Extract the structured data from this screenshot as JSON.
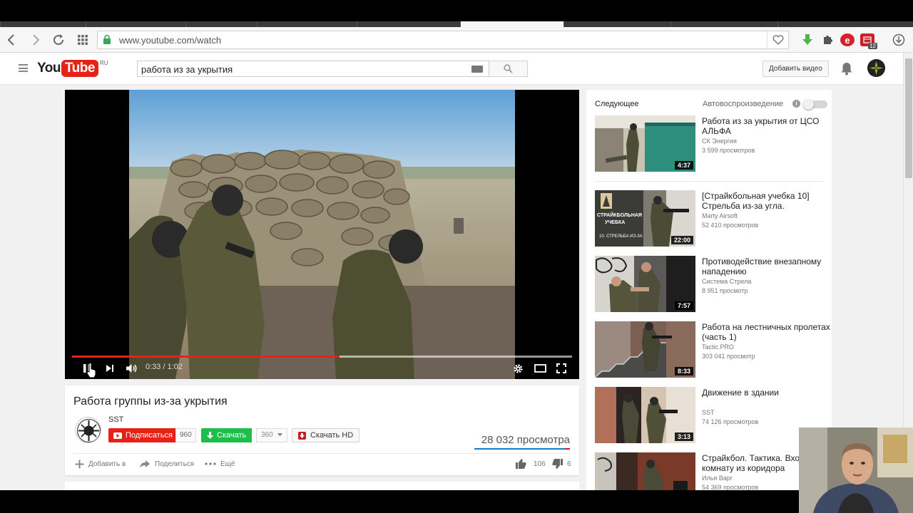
{
  "browser": {
    "url": "www.youtube.com/watch",
    "extension_badge": "12"
  },
  "masthead": {
    "logo_you": "You",
    "logo_tube": "Tube",
    "logo_region": "RU",
    "search_value": "работа из за укрытия",
    "upload_label": "Добавить видео"
  },
  "player": {
    "time": "0:33 / 1:02",
    "progress": 0.535,
    "buffered": 1.0
  },
  "video": {
    "title": "Работа группы из-за укрытия",
    "channel": "SST",
    "subscribe_label": "Подписаться",
    "subscribers": "960",
    "download_label": "Скачать",
    "download_count": "360",
    "download_hd_label": "Скачать HD",
    "views": "28 032 просмотра",
    "add_to_label": "Добавить в",
    "share_label": "Поделиться",
    "more_label": "Ещё",
    "likes": "106",
    "dislikes": "6",
    "like_ratio": 0.946
  },
  "sidebar": {
    "up_next_label": "Следующее",
    "autoplay_label": "Автовоспроизведение",
    "recommendations": [
      {
        "title": "Работа из за укрытия от ЦСО АЛЬФА",
        "channel": "СК Энергия",
        "views": "3 599 просмотров",
        "duration": "4:37"
      },
      {
        "title": "[Страйкбольная учебка 10] Стрельба из-за угла.",
        "channel": "Marty Airsoft",
        "views": "52 410 просмотров",
        "duration": "22:00",
        "thumb_text_1": "СТРАЙКБОЛЬНАЯ",
        "thumb_text_2": "УЧЕБКА",
        "thumb_text_3": "10. СТРЕЛЬБА ИЗ-ЗА"
      },
      {
        "title": "Противодействие внезапному нападению",
        "channel": "Система Стрела",
        "views": "8 951 просмотр",
        "duration": "7:57"
      },
      {
        "title": "Работа на лестничных пролетах (часть 1)",
        "channel": "Tactic.PRO",
        "views": "303 041 просмотр",
        "duration": "8:33"
      },
      {
        "title": "Движение в здании",
        "channel": "SST",
        "views": "74 126 просмотров",
        "duration": "3:13"
      },
      {
        "title": "Страйкбол. Тактика. Вход в комнату из коридора",
        "channel": "Илья Варг",
        "views": "54 369 просмотров",
        "duration": ""
      }
    ]
  },
  "colors": {
    "brand_red": "#e62117",
    "download_green": "#1fbe4a",
    "link_blue": "#167ac6"
  }
}
